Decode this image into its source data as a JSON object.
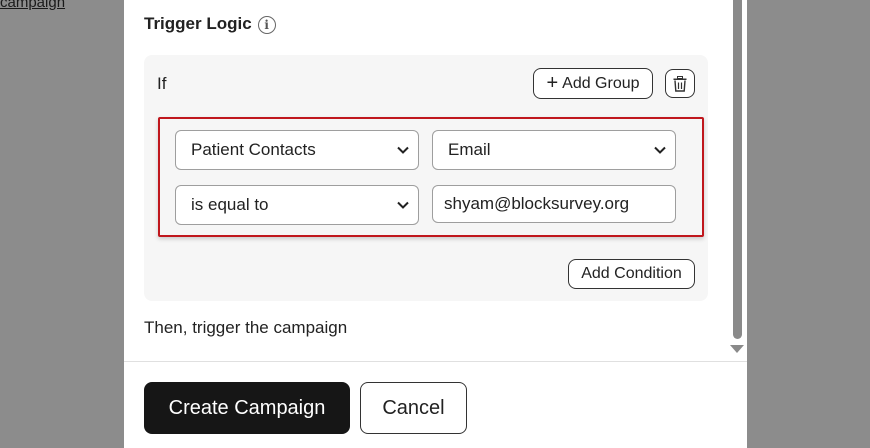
{
  "background": {
    "link_text": "campaign"
  },
  "modal": {
    "section_title": "Trigger Logic",
    "info_icon": "info-icon",
    "group": {
      "if_label": "If",
      "add_group_label": "Add Group",
      "add_group_icon": "plus-icon",
      "delete_icon": "trash-icon",
      "condition": {
        "source_select": "Patient Contacts",
        "field_select": "Email",
        "operator_select": "is equal to",
        "value_input": "shyam@blocksurvey.org"
      },
      "add_condition_label": "Add Condition"
    },
    "then_text": "Then, trigger the campaign"
  },
  "footer": {
    "create_label": "Create Campaign",
    "cancel_label": "Cancel"
  },
  "colors": {
    "highlight_border": "#c0171d",
    "primary_button": "#161616",
    "overlay": "#8c8c8c"
  }
}
